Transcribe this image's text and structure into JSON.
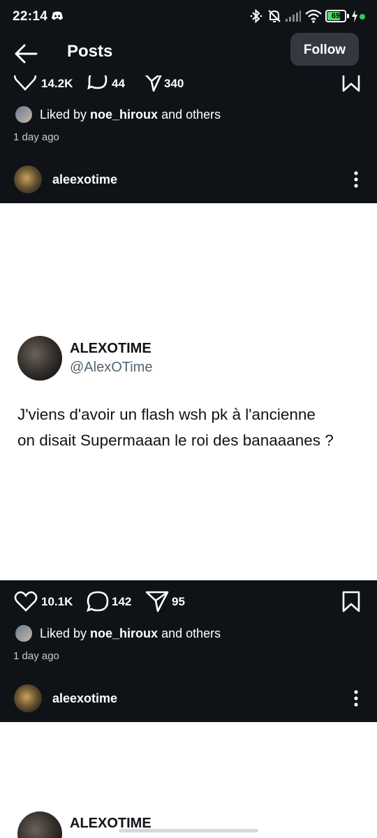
{
  "status_bar": {
    "time": "22:14",
    "battery": "69"
  },
  "header": {
    "title": "Posts",
    "follow_label": "Follow"
  },
  "post1": {
    "likes": "14.2K",
    "comments": "44",
    "shares": "340",
    "liked_prefix": "Liked by ",
    "liked_user": "noe_hiroux",
    "liked_suffix": " and others",
    "time_ago": "1 day ago",
    "next_username": "aleexotime"
  },
  "tweet": {
    "name": "ALEXOTIME",
    "handle": "@AlexOTime",
    "line1": "J'viens d'avoir un flash wsh pk à l'ancienne",
    "line2": "on disait Supermaaan le roi des banaaanes ?"
  },
  "post2": {
    "likes": "10.1K",
    "comments": "142",
    "shares": "95",
    "liked_prefix": "Liked by ",
    "liked_user": "noe_hiroux",
    "liked_suffix": " and others",
    "time_ago": "1 day ago",
    "next_username": "aleexotime"
  },
  "tweet2_partial_name": "ALEXOTIME",
  "colors": {
    "background": "#0f1217",
    "follow_button": "#343841",
    "battery_fill": "#4cd964"
  }
}
